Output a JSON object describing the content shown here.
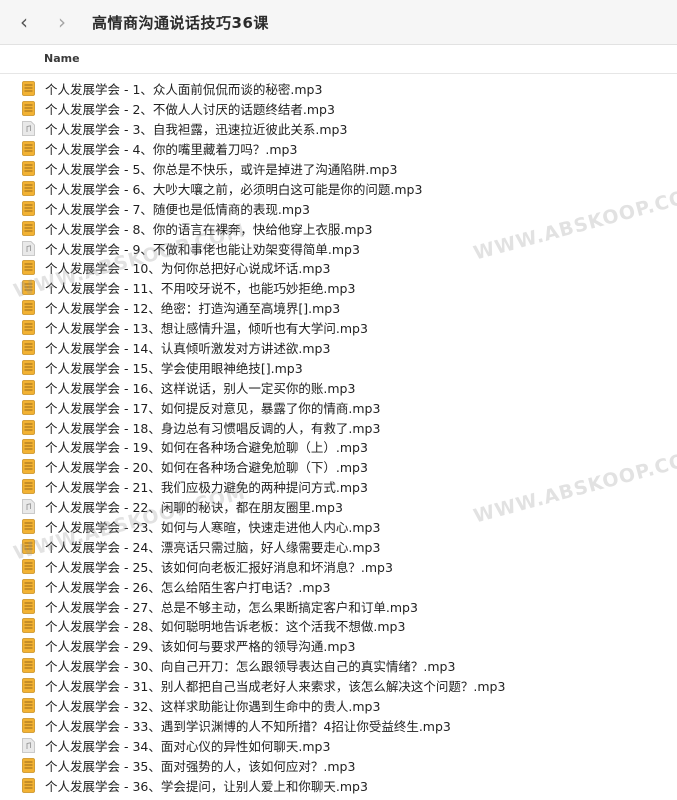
{
  "toolbar": {
    "back_icon": "chevron-left-icon",
    "forward_icon": "chevron-right-icon",
    "title": "高情商沟通说话技巧36课"
  },
  "list_header": {
    "name_label": "Name"
  },
  "colors": {
    "doc_icon": "#f2b233",
    "doc_icon_line": "#9a6a1a",
    "audio_icon": "#e9e9e9"
  },
  "files": [
    {
      "name": "个人发展学会 - 1、众人面前侃侃而谈的秘密.mp3",
      "icon": "document-icon"
    },
    {
      "name": "个人发展学会 - 2、不做人人讨厌的话题终结者.mp3",
      "icon": "document-icon"
    },
    {
      "name": "个人发展学会 - 3、自我袒露，迅速拉近彼此关系.mp3",
      "icon": "audio-file-icon"
    },
    {
      "name": "个人发展学会 - 4、你的嘴里藏着刀吗？.mp3",
      "icon": "document-icon"
    },
    {
      "name": "个人发展学会 - 5、你总是不快乐，或许是掉进了沟通陷阱.mp3",
      "icon": "document-icon"
    },
    {
      "name": "个人发展学会 - 6、大吵大嚷之前，必须明白这可能是你的问题.mp3",
      "icon": "document-icon"
    },
    {
      "name": "个人发展学会 - 7、随便也是低情商的表现.mp3",
      "icon": "document-icon"
    },
    {
      "name": "个人发展学会 - 8、你的语言在裸奔，快给他穿上衣服.mp3",
      "icon": "document-icon"
    },
    {
      "name": "个人发展学会 - 9、不做和事佬也能让劝架变得简单.mp3",
      "icon": "audio-file-icon"
    },
    {
      "name": "个人发展学会 - 10、为何你总把好心说成坏话.mp3",
      "icon": "document-icon"
    },
    {
      "name": "个人发展学会 - 11、不用咬牙说不，也能巧妙拒绝.mp3",
      "icon": "document-icon"
    },
    {
      "name": "个人发展学会 - 12、绝密：打造沟通至高境界[].mp3",
      "icon": "document-icon"
    },
    {
      "name": "个人发展学会 - 13、想让感情升温，倾听也有大学问.mp3",
      "icon": "document-icon"
    },
    {
      "name": "个人发展学会 - 14、认真倾听激发对方讲述欲.mp3",
      "icon": "document-icon"
    },
    {
      "name": "个人发展学会 - 15、学会使用眼神绝技[].mp3",
      "icon": "document-icon"
    },
    {
      "name": "个人发展学会 - 16、这样说话，别人一定买你的账.mp3",
      "icon": "document-icon"
    },
    {
      "name": "个人发展学会 - 17、如何提反对意见，暴露了你的情商.mp3",
      "icon": "document-icon"
    },
    {
      "name": "个人发展学会 - 18、身边总有习惯唱反调的人，有救了.mp3",
      "icon": "document-icon"
    },
    {
      "name": "个人发展学会 - 19、如何在各种场合避免尬聊（上）.mp3",
      "icon": "document-icon"
    },
    {
      "name": "个人发展学会 - 20、如何在各种场合避免尬聊（下）.mp3",
      "icon": "document-icon"
    },
    {
      "name": "个人发展学会 - 21、我们应极力避免的两种提问方式.mp3",
      "icon": "document-icon"
    },
    {
      "name": "个人发展学会 - 22、闲聊的秘诀，都在朋友圈里.mp3",
      "icon": "audio-file-icon"
    },
    {
      "name": "个人发展学会 - 23、如何与人寒暄，快速走进他人内心.mp3",
      "icon": "document-icon"
    },
    {
      "name": "个人发展学会 - 24、漂亮话只需过脑，好人缘需要走心.mp3",
      "icon": "document-icon"
    },
    {
      "name": "个人发展学会 - 25、该如何向老板汇报好消息和坏消息？.mp3",
      "icon": "document-icon"
    },
    {
      "name": "个人发展学会 - 26、怎么给陌生客户打电话？.mp3",
      "icon": "document-icon"
    },
    {
      "name": "个人发展学会 - 27、总是不够主动，怎么果断搞定客户和订单.mp3",
      "icon": "document-icon"
    },
    {
      "name": "个人发展学会 - 28、如何聪明地告诉老板：这个活我不想做.mp3",
      "icon": "document-icon"
    },
    {
      "name": "个人发展学会 - 29、该如何与要求严格的领导沟通.mp3",
      "icon": "document-icon"
    },
    {
      "name": "个人发展学会 - 30、向自己开刀：怎么跟领导表达自己的真实情绪？.mp3",
      "icon": "document-icon"
    },
    {
      "name": "个人发展学会 - 31、别人都把自己当成老好人来索求，该怎么解决这个问题？.mp3",
      "icon": "document-icon"
    },
    {
      "name": "个人发展学会 - 32、这样求助能让你遇到生命中的贵人.mp3",
      "icon": "document-icon"
    },
    {
      "name": "个人发展学会 - 33、遇到学识渊博的人不知所措？4招让你受益终生.mp3",
      "icon": "document-icon"
    },
    {
      "name": "个人发展学会 - 34、面对心仪的异性如何聊天.mp3",
      "icon": "audio-file-icon"
    },
    {
      "name": "个人发展学会 - 35、面对强势的人，该如何应对？.mp3",
      "icon": "document-icon"
    },
    {
      "name": "个人发展学会 - 36、学会提问，让别人爱上和你聊天.mp3",
      "icon": "document-icon"
    }
  ],
  "watermarks": [
    "WWW.ABSKOOP.COM",
    "WWW.ABSKOOP.COM",
    "WWW.ABSKOOP.COM",
    "WWW.ABSKOOP.COM"
  ]
}
